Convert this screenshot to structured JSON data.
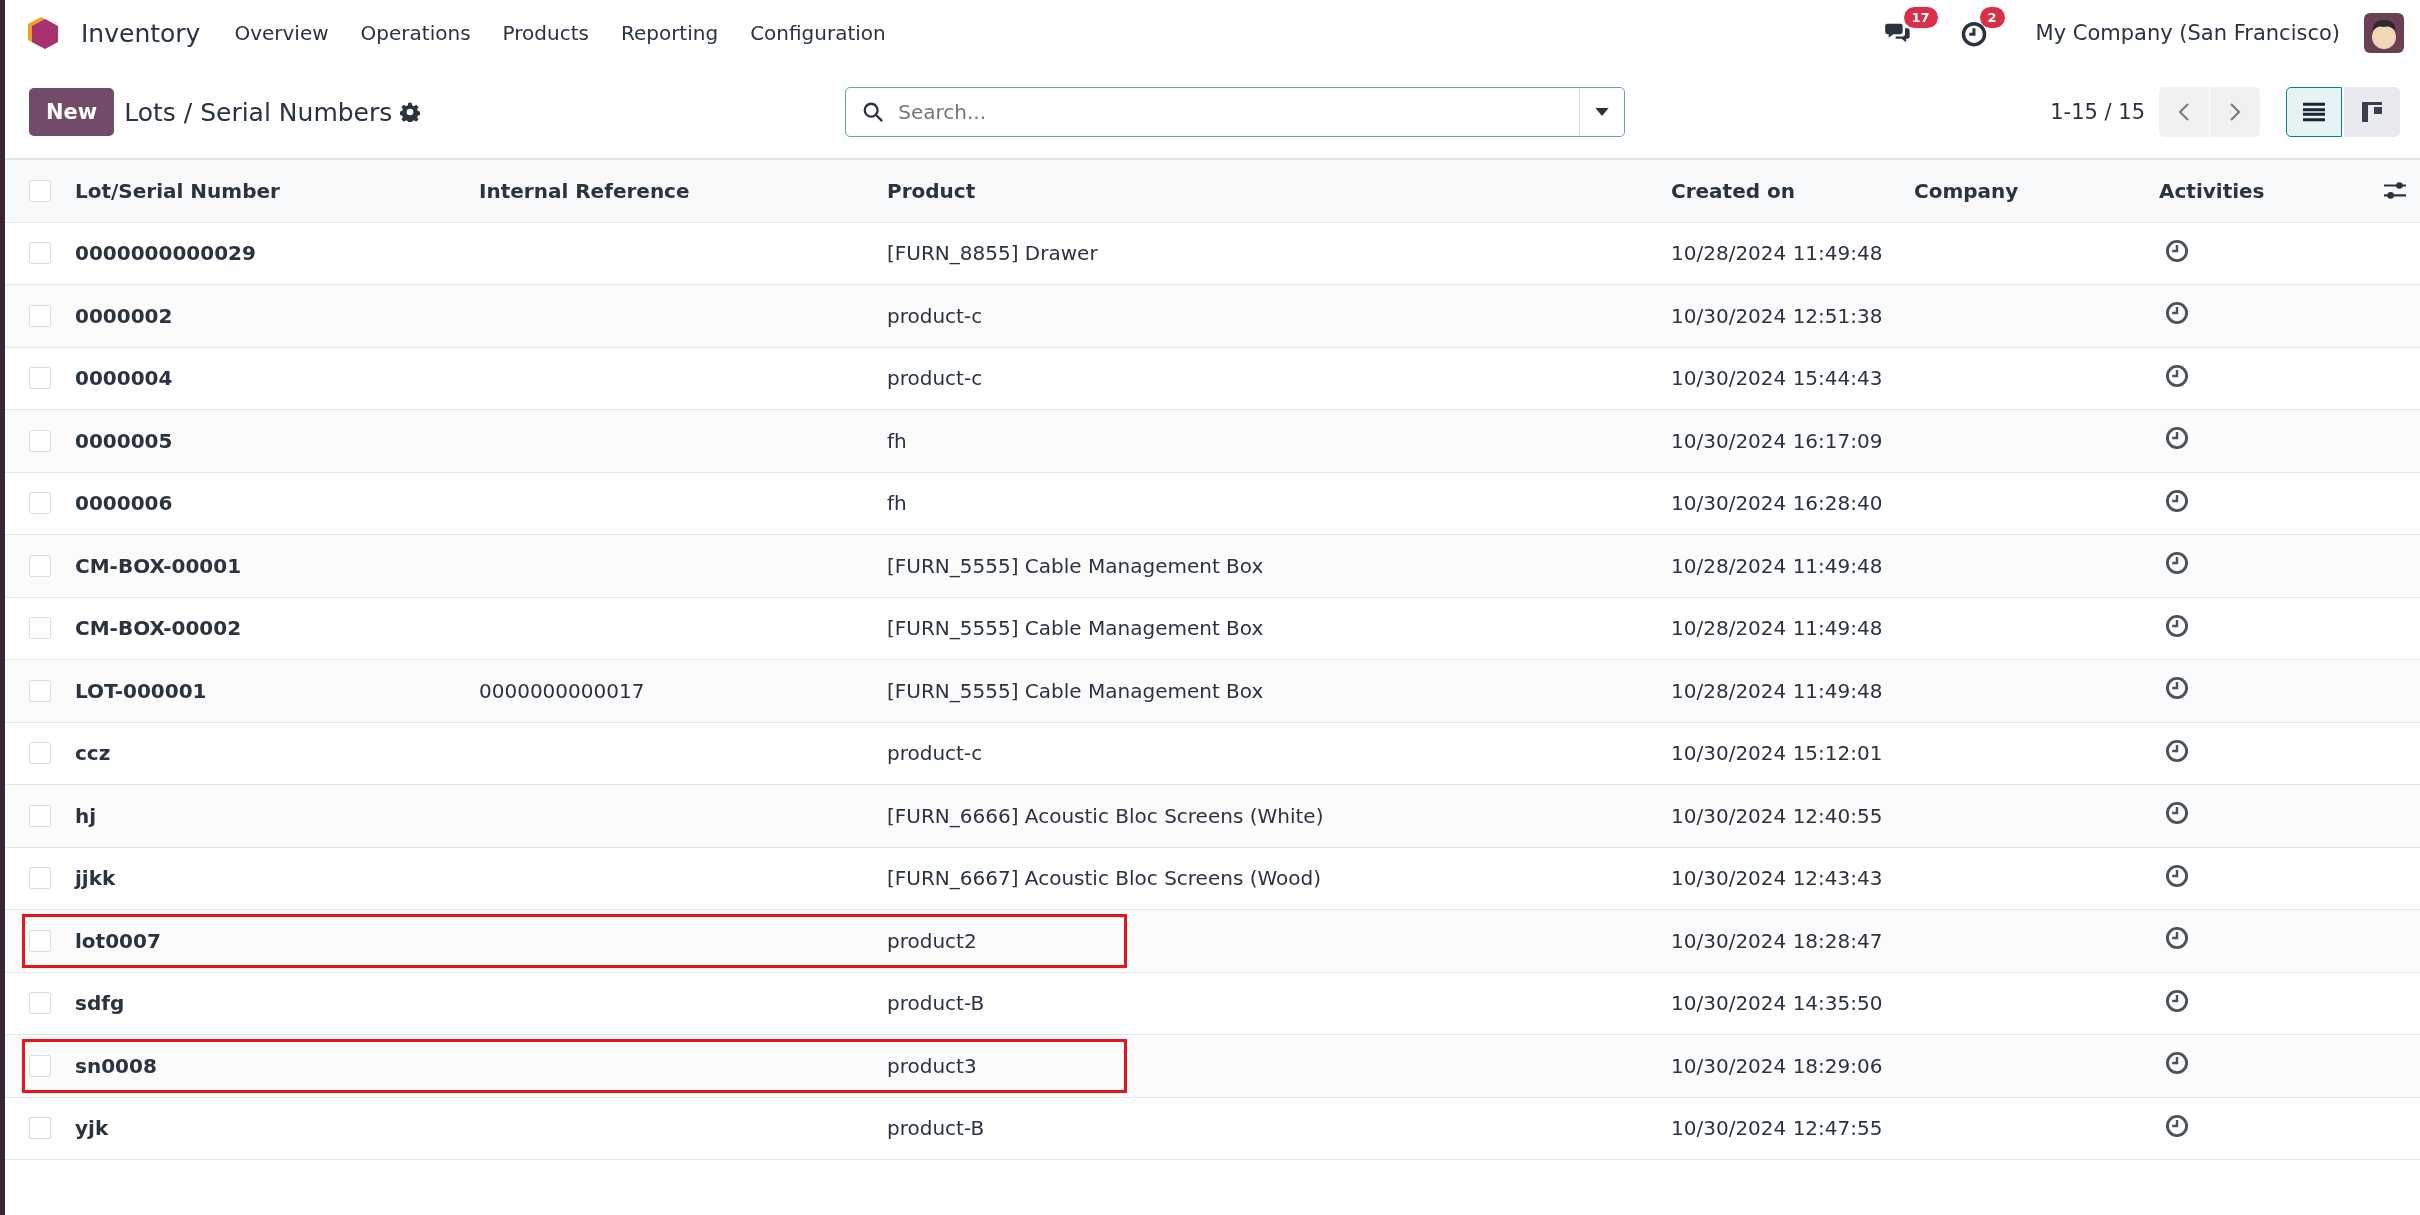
{
  "app": {
    "name": "Inventory"
  },
  "menu": [
    "Overview",
    "Operations",
    "Products",
    "Reporting",
    "Configuration"
  ],
  "systray": {
    "messages_count": "17",
    "activities_count": "2",
    "company": "My Company (San Francisco)"
  },
  "control_panel": {
    "new_button": "New",
    "title": "Lots / Serial Numbers",
    "search": {
      "placeholder": "Search..."
    },
    "pager": "1-15 / 15",
    "views": [
      {
        "kind": "list",
        "selected": true
      },
      {
        "kind": "kanban",
        "selected": false
      }
    ]
  },
  "table": {
    "select_all_checked": false,
    "columns": [
      "Lot/Serial Number",
      "Internal Reference",
      "Product",
      "Created on",
      "Company",
      "Activities"
    ],
    "rows": [
      {
        "lot": "0000000000029",
        "ref": "",
        "product": "[FURN_8855] Drawer",
        "created": "10/28/2024 11:49:48",
        "highlighted": false,
        "checked": false
      },
      {
        "lot": "0000002",
        "ref": "",
        "product": "product-c",
        "created": "10/30/2024 12:51:38",
        "highlighted": false,
        "checked": false
      },
      {
        "lot": "0000004",
        "ref": "",
        "product": "product-c",
        "created": "10/30/2024 15:44:43",
        "highlighted": false,
        "checked": false
      },
      {
        "lot": "0000005",
        "ref": "",
        "product": "fh",
        "created": "10/30/2024 16:17:09",
        "highlighted": false,
        "checked": false
      },
      {
        "lot": "0000006",
        "ref": "",
        "product": "fh",
        "created": "10/30/2024 16:28:40",
        "highlighted": false,
        "checked": false
      },
      {
        "lot": "CM-BOX-00001",
        "ref": "",
        "product": "[FURN_5555] Cable Management Box",
        "created": "10/28/2024 11:49:48",
        "highlighted": false,
        "checked": false
      },
      {
        "lot": "CM-BOX-00002",
        "ref": "",
        "product": "[FURN_5555] Cable Management Box",
        "created": "10/28/2024 11:49:48",
        "highlighted": false,
        "checked": false
      },
      {
        "lot": "LOT-000001",
        "ref": "0000000000017",
        "product": "[FURN_5555] Cable Management Box",
        "created": "10/28/2024 11:49:48",
        "highlighted": false,
        "checked": false
      },
      {
        "lot": "ccz",
        "ref": "",
        "product": "product-c",
        "created": "10/30/2024 15:12:01",
        "highlighted": false,
        "checked": false
      },
      {
        "lot": "hj",
        "ref": "",
        "product": "[FURN_6666] Acoustic Bloc Screens (White)",
        "created": "10/30/2024 12:40:55",
        "highlighted": false,
        "checked": false
      },
      {
        "lot": "jjkk",
        "ref": "",
        "product": "[FURN_6667] Acoustic Bloc Screens (Wood)",
        "created": "10/30/2024 12:43:43",
        "highlighted": false,
        "checked": false
      },
      {
        "lot": "lot0007",
        "ref": "",
        "product": "product2",
        "created": "10/30/2024 18:28:47",
        "highlighted": true,
        "checked": false
      },
      {
        "lot": "sdfg",
        "ref": "",
        "product": "product-B",
        "created": "10/30/2024 14:35:50",
        "highlighted": false,
        "checked": false
      },
      {
        "lot": "sn0008",
        "ref": "",
        "product": "product3",
        "created": "10/30/2024 18:29:06",
        "highlighted": true,
        "checked": false
      },
      {
        "lot": "yjk",
        "ref": "",
        "product": "product-B",
        "created": "10/30/2024 12:47:55",
        "highlighted": false,
        "checked": false
      }
    ]
  }
}
